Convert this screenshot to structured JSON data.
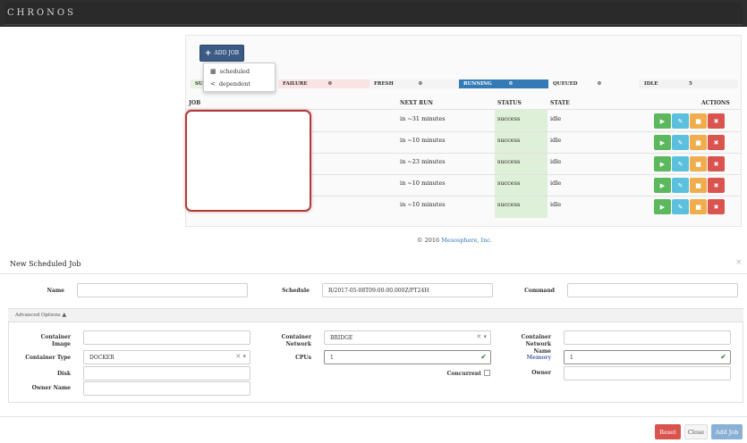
{
  "header": {
    "brand": "CHRONOS"
  },
  "toolbar": {
    "add_job": "ADD JOB"
  },
  "dropdown": {
    "items": [
      {
        "label": "scheduled"
      },
      {
        "label": "dependent"
      }
    ]
  },
  "stats": [
    {
      "label": "SU",
      "value": ""
    },
    {
      "label": "FAILURE",
      "value": "0"
    },
    {
      "label": "FRESH",
      "value": "0"
    },
    {
      "label": "RUNNING",
      "value": "0"
    },
    {
      "label": "QUEUED",
      "value": "0"
    },
    {
      "label": "IDLE",
      "value": "5"
    }
  ],
  "table": {
    "headers": {
      "job": "JOB",
      "next_run": "NEXT RUN",
      "status": "STATUS",
      "state": "STATE",
      "actions": "ACTIONS"
    },
    "rows": [
      {
        "next_run": "in ~31 minutes",
        "status": "success",
        "state": "idle"
      },
      {
        "next_run": "in ~10 minutes",
        "status": "success",
        "state": "idle"
      },
      {
        "next_run": "in ~23 minutes",
        "status": "success",
        "state": "idle"
      },
      {
        "next_run": "in ~10 minutes",
        "status": "success",
        "state": "idle"
      },
      {
        "next_run": "in ~10 minutes",
        "status": "success",
        "state": "idle"
      }
    ]
  },
  "footer": {
    "copyright": "© 2016 ",
    "link": "Mesosphere, Inc."
  },
  "modal": {
    "title": "New Scheduled Job",
    "fields": {
      "name": {
        "label": "Name",
        "value": ""
      },
      "schedule": {
        "label": "Schedule",
        "value": "R/2017-05-08T09:00:00.000Z/PT24H"
      },
      "command": {
        "label": "Command",
        "value": ""
      },
      "advanced": "Advanced Options",
      "container_image": {
        "label": "Container Image",
        "value": ""
      },
      "container_network": {
        "label": "Container Network",
        "value": "BRIDGE"
      },
      "container_network_name": {
        "label": "Container Network Name",
        "value": ""
      },
      "container_type": {
        "label": "Container Type",
        "value": "DOCKER"
      },
      "cpus": {
        "label": "CPUs",
        "value": "1"
      },
      "memory": {
        "label": "Memory",
        "value": "1"
      },
      "disk": {
        "label": "Disk",
        "value": ""
      },
      "concurrent": {
        "label": "Concurrent"
      },
      "owner": {
        "label": "Owner",
        "value": ""
      },
      "owner_name": {
        "label": "Owner Name",
        "value": ""
      }
    },
    "buttons": {
      "reset": "Reset",
      "close": "Close",
      "add_job": "Add Job"
    }
  },
  "colors": {
    "primary": "#3b5a84",
    "success": "#5cb85c",
    "info": "#5bc0de",
    "warning": "#f0ad4e",
    "danger": "#d9534f",
    "running": "#337ab7"
  }
}
